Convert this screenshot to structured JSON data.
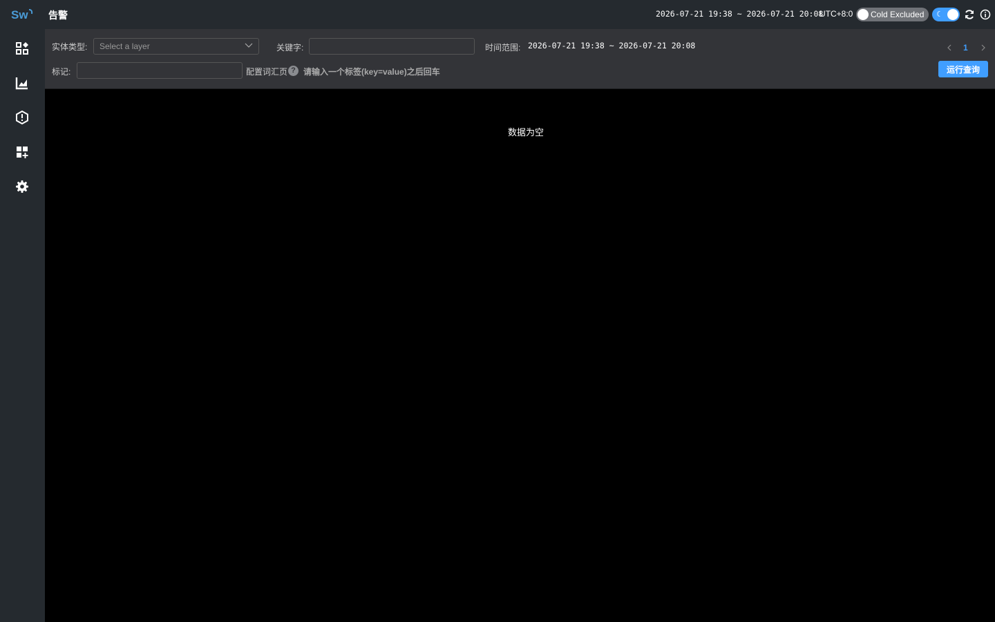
{
  "app": {
    "logo_text": "Sw"
  },
  "sidebar": {
    "items": [
      {
        "icon": "dashboard-icon"
      },
      {
        "icon": "chart-icon"
      },
      {
        "icon": "alert-shield-icon"
      },
      {
        "icon": "add-widget-icon"
      },
      {
        "icon": "gear-icon"
      }
    ]
  },
  "header": {
    "title": "告警",
    "duration": "2026-07-21 19:38 ~ 2026-07-21 20:08",
    "timezone": "UTC+8:0",
    "cold_label": "Cold Excluded",
    "cold_enabled": false,
    "dark_mode_enabled": true
  },
  "filters": {
    "entity_type_label": "实体类型:",
    "entity_type_placeholder": "Select a layer",
    "keyword_label": "关键字:",
    "keyword_value": "",
    "time_range_label": "时间范围:",
    "time_range_value": "2026-07-21 19:38 ~ 2026-07-21 20:08",
    "tag_label": "标记:",
    "tag_value": "",
    "vocab_link": "配置词汇页",
    "tag_tip": "请输入一个标签(key=value)之后回车",
    "run_button": "运行查询",
    "current_page": "1"
  },
  "main": {
    "empty_text": "数据为空"
  },
  "colors": {
    "accent": "#409eff",
    "panel": "#333438",
    "nav": "#252a2f"
  }
}
